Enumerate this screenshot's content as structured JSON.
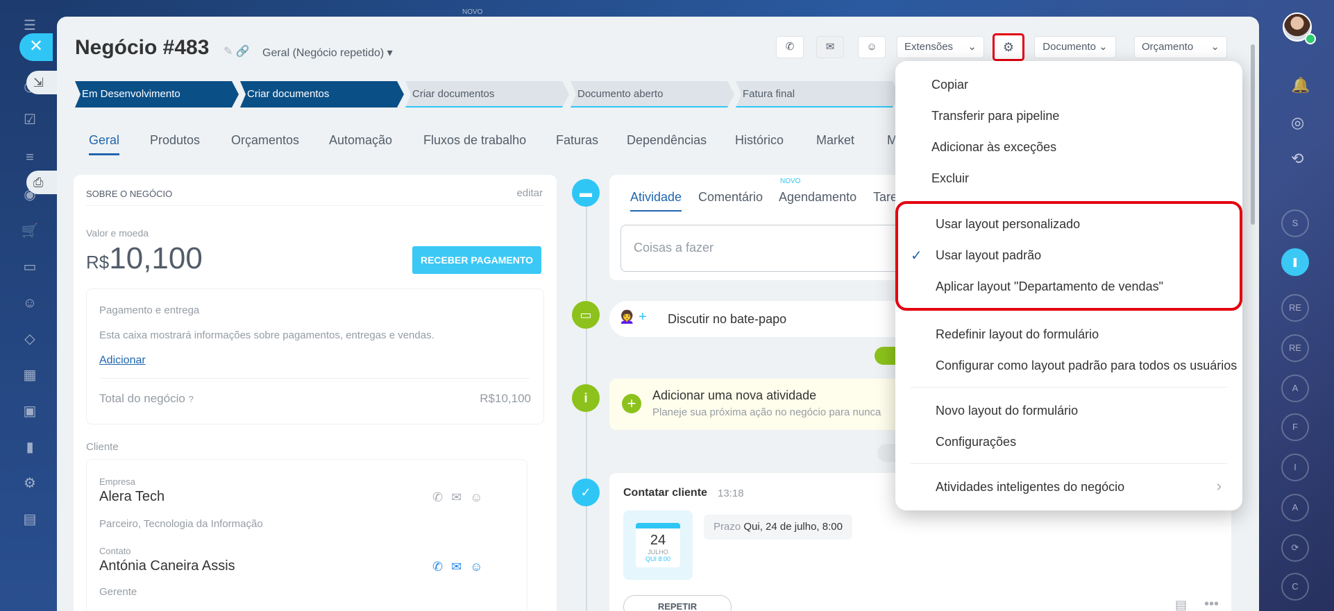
{
  "window": {
    "top_label": "NOVO"
  },
  "deal": {
    "title": "Negócio #483",
    "category": "Geral (Negócio repetido)"
  },
  "toolbar": {
    "extensions": "Extensões",
    "document": "Documento",
    "budget": "Orçamento"
  },
  "stages": [
    {
      "label": "Em Desenvolvimento",
      "active": true
    },
    {
      "label": "Criar documentos",
      "active": true
    },
    {
      "label": "Criar documentos",
      "active": false
    },
    {
      "label": "Documento aberto",
      "active": false
    },
    {
      "label": "Fatura final",
      "active": false
    }
  ],
  "tabs": [
    "Geral",
    "Produtos",
    "Orçamentos",
    "Automação",
    "Fluxos de trabalho",
    "Faturas",
    "Dependências",
    "Histórico",
    "Market",
    "M"
  ],
  "about": {
    "heading": "SOBRE O NEGÓCIO",
    "edit": "editar",
    "value_label": "Valor e moeda",
    "currency": "R$",
    "amount": "10,100",
    "receive_payment": "RECEBER PAGAMENTO",
    "payment_title": "Pagamento e entrega",
    "payment_desc": "Esta caixa mostrará informações sobre pagamentos, entregas e vendas.",
    "add_link": "Adicionar",
    "total_label": "Total do negócio",
    "total_value": "R$10,100",
    "client_label": "Cliente",
    "company_label": "Empresa",
    "company_name": "Alera Tech",
    "company_desc": "Parceiro, Tecnologia da Informação",
    "contact_label": "Contato",
    "contact_name": "Antónia Caneira Assis",
    "manager_label": "Gerente"
  },
  "activity": {
    "tabs": [
      "Atividade",
      "Comentário",
      "Agendamento",
      "Tare"
    ],
    "new_badge": "NOVO",
    "todo_placeholder": "Coisas a fazer",
    "chat_label": "Discutir no bate-papo",
    "add_title": "Adicionar uma nova atividade",
    "add_desc": "Planeje sua próxima ação no negócio para nunca",
    "contact_title": "Contatar cliente",
    "contact_time": "13:18",
    "cal_day": "24",
    "cal_month": "JULHO",
    "cal_sub": "QUI 8:00",
    "deadline_label": "Prazo",
    "deadline_value": "Qui, 24 de julho, 8:00",
    "repeat": "REPETIR"
  },
  "menu": {
    "items": [
      "Copiar",
      "Transferir para pipeline",
      "Adicionar às exceções",
      "Excluir",
      "Usar layout personalizado",
      "Usar layout padrão",
      "Aplicar layout \"Departamento de vendas\"",
      "Redefinir layout do formulário",
      "Configurar como layout padrão para todos os usuários",
      "Novo layout do formulário",
      "Configurações",
      "Atividades inteligentes do negócio"
    ],
    "checked_index": 5
  },
  "right_rail": [
    "S",
    "RE",
    "RE",
    "A",
    "F",
    "I",
    "A",
    "C"
  ],
  "colors": {
    "accent": "#2fc6f6",
    "stage_active": "#0b4f87",
    "highlight": "#e3000f"
  }
}
